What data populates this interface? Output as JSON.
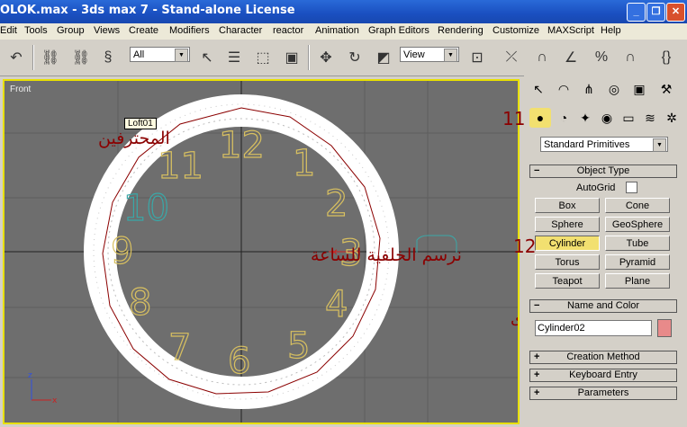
{
  "window": {
    "title": "OLOK.max - 3ds max 7  - Stand-alone License"
  },
  "menu": [
    "Edit",
    "Tools",
    "Group",
    "Views",
    "Create",
    "Modifiers",
    "Character",
    "reactor",
    "Animation",
    "Graph Editors",
    "Rendering",
    "Customize",
    "MAXScript",
    "Help"
  ],
  "toolbar": {
    "selection_filter": "All",
    "ref_coord": "View"
  },
  "viewport": {
    "label": "Front",
    "tooltip": "Loft01",
    "clock_numbers": [
      "12",
      "1",
      "2",
      "3",
      "4",
      "5",
      "6",
      "7",
      "8",
      "9",
      "10",
      "11"
    ],
    "text_center": "نرسم الخلفية للساعة",
    "text_topleft": "المحترفين",
    "text_bottomright": "المبتدى",
    "axis_z": "z",
    "axis_x": "x"
  },
  "panel": {
    "annotation_11": "11",
    "annotation_12": "12",
    "category": "Standard Primitives",
    "object_type_header": "Object Type",
    "autogrid": "AutoGrid",
    "buttons": [
      "Box",
      "Cone",
      "Sphere",
      "GeoSphere",
      "Cylinder",
      "Tube",
      "Torus",
      "Pyramid",
      "Teapot",
      "Plane"
    ],
    "name_color_header": "Name and Color",
    "object_name": "Cylinder02",
    "object_color": "#e88a8a",
    "creation_method": "Creation Method",
    "keyboard_entry": "Keyboard Entry",
    "parameters": "Parameters"
  },
  "colors": {
    "viewport_bg": "#6e6e6e",
    "active_border": "#e8e000",
    "clock_num": "#d8c060",
    "accent_red": "#8b0000"
  }
}
